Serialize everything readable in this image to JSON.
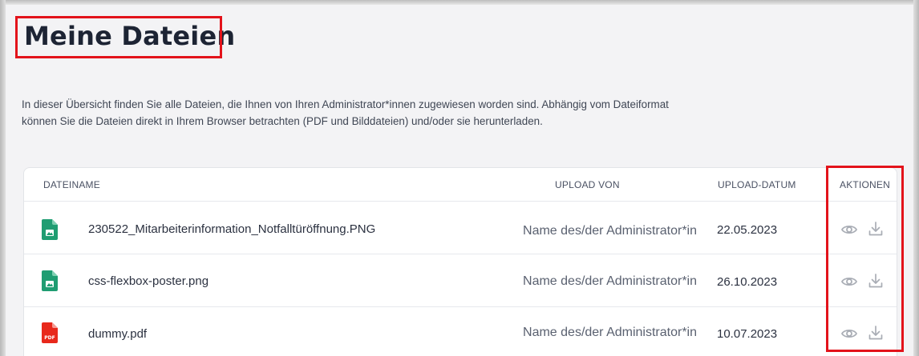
{
  "page": {
    "title": "Meine Dateien",
    "intro": "In dieser Übersicht finden Sie alle Dateien, die Ihnen von Ihren Administrator*innen zugewiesen worden sind. Abhängig vom Dateiformat können Sie die Dateien direkt in Ihrem Browser betrachten (PDF und Bilddateien) und/oder sie herunterladen."
  },
  "table": {
    "headers": {
      "filename": "DATEINAME",
      "uploaded_by": "UPLOAD VON",
      "upload_date": "UPLOAD-DATUM",
      "actions": "AKTIONEN"
    },
    "rows": [
      {
        "filename": "230522_Mitarbeiterinformation_Notfalltüröffnung.PNG",
        "uploaded_by": "Name des/der Administrator*in",
        "date": "22.05.2023",
        "type": "image",
        "icon": "image-file-icon"
      },
      {
        "filename": "css-flexbox-poster.png",
        "uploaded_by": "Name des/der Administrator*in",
        "date": "26.10.2023",
        "type": "image",
        "icon": "image-file-icon"
      },
      {
        "filename": "dummy.pdf",
        "uploaded_by": "Name des/der Administrator*in",
        "date": "10.07.2023",
        "type": "pdf",
        "icon": "pdf-file-icon",
        "icon_label": "PDF"
      }
    ],
    "action_icons": [
      "eye-icon",
      "download-icon"
    ]
  },
  "colors": {
    "image_icon": "#1f9d72",
    "pdf_icon": "#e8281b",
    "highlight": "#e3131b",
    "action_icon": "#a9adb5"
  }
}
